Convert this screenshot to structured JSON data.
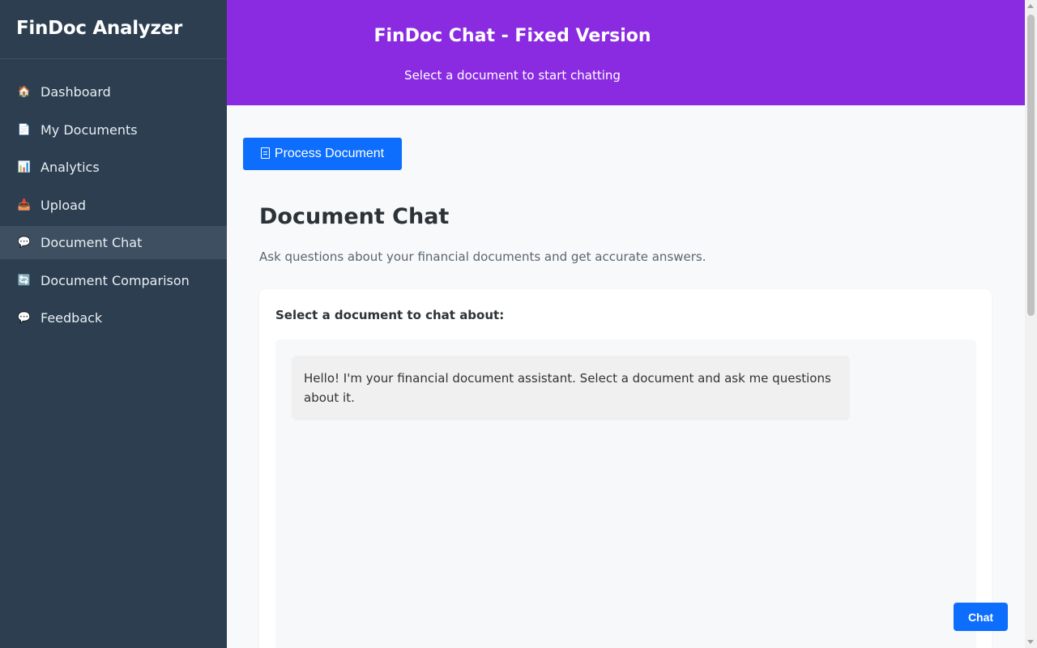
{
  "sidebar": {
    "brand": "FinDoc Analyzer",
    "items": [
      {
        "label": "Dashboard",
        "icon": "house-icon",
        "glyph": "🏠"
      },
      {
        "label": "My Documents",
        "icon": "document-icon",
        "glyph": "📄"
      },
      {
        "label": "Analytics",
        "icon": "bar-chart-icon",
        "glyph": "📊"
      },
      {
        "label": "Upload",
        "icon": "inbox-tray-icon",
        "glyph": "📥"
      },
      {
        "label": "Document Chat",
        "icon": "speech-balloon-icon",
        "glyph": "💬"
      },
      {
        "label": "Document Comparison",
        "icon": "sync-arrows-icon",
        "glyph": "🔄"
      },
      {
        "label": "Feedback",
        "icon": "speech-balloon-icon",
        "glyph": "💬"
      }
    ],
    "active_item": "Document Chat"
  },
  "banner": {
    "title": "FinDoc Chat - Fixed Version",
    "subtitle": "Select a document to start chatting"
  },
  "toolbar": {
    "process_label": "Process Document"
  },
  "main": {
    "title": "Document Chat",
    "description": "Ask questions about your financial documents and get accurate answers.",
    "select_label": "Select a document to chat about:"
  },
  "chat": {
    "messages": [
      {
        "role": "assistant",
        "text": "Hello! I'm your financial document assistant. Select a document and ask me questions about it."
      }
    ]
  },
  "fab": {
    "label": "Chat"
  },
  "colors": {
    "sidebar_bg": "#2c3e50",
    "sidebar_active": "#3d4f61",
    "banner_bg": "#8a2be2",
    "primary": "#0d6efd",
    "page_bg": "#f8f9fa"
  }
}
